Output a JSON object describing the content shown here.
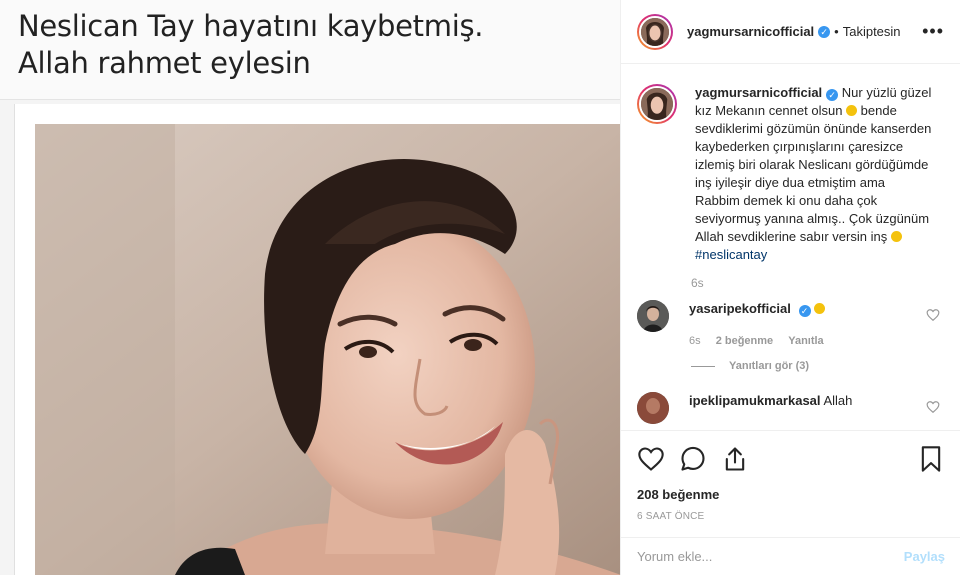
{
  "post_image": {
    "headline_line1": "Neslican Tay hayatını kaybetmiş.",
    "headline_line2": "Allah rahmet eylesin"
  },
  "header": {
    "username": "yagmursarnicofficial",
    "verified_icon": "verified-badge-icon",
    "separator": "•",
    "follow_status": "Takiptesin",
    "more_icon": "more-options-icon"
  },
  "caption": {
    "username": "yagmursarnicofficial",
    "text_part1": "Nur yüzlü güzel kız Mekanın cennet olsun",
    "text_part2": "bende sevdiklerimi gözümün önünde kanserden kaybederken çırpınışlarını çaresizce izlemiş biri olarak Neslicanı gördüğümde inş iyileşir diye dua etmiştim ama Rabbim demek ki onu daha çok seviyormuş yanına almış.. Çok üzgünüm Allah sevdiklerine sabır versin inş",
    "hashtag": "#neslicantay",
    "time": "6s"
  },
  "comments": [
    {
      "username": "yasaripekofficial",
      "text": "",
      "time": "6s",
      "likes": "2 beğenme",
      "reply": "Yanıtla",
      "view_replies": "Yanıtları gör (3)"
    },
    {
      "username": "ipeklipamukmarkasal",
      "text": "Allah"
    }
  ],
  "actions": {
    "like_icon": "heart-icon",
    "comment_icon": "comment-icon",
    "share_icon": "share-icon",
    "save_icon": "bookmark-icon",
    "likes_count": "208 beğenme",
    "post_time": "6 SAAT ÖNCE"
  },
  "comment_box": {
    "placeholder": "Yorum ekle...",
    "post_label": "Paylaş"
  },
  "colors": {
    "link": "#003569",
    "verified": "#3897f0",
    "muted": "#999999",
    "post_button_disabled": "#b2dffc"
  }
}
